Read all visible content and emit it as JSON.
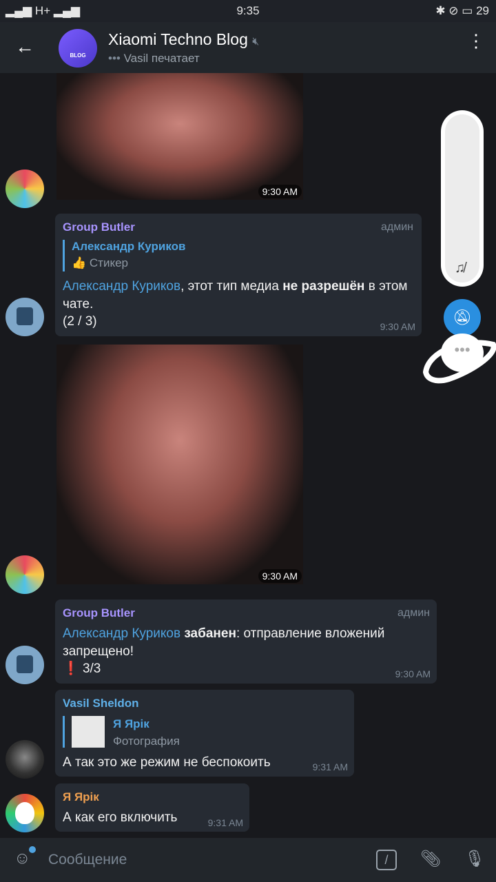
{
  "status_bar": {
    "left": "H+",
    "time": "9:35",
    "battery": "29"
  },
  "header": {
    "title": "Xiaomi Techno Blog",
    "subtitle": "Vasil печатает",
    "avatar_text": "BLOG"
  },
  "messages": {
    "m1": {
      "time": "9:30 AM"
    },
    "m2": {
      "sender": "Group Butler",
      "badge": "админ",
      "quote_author": "Александр Куриков",
      "quote_text": "Стикер",
      "link": "Александр Куриков",
      "text1": ", этот тип медиа ",
      "bold": "не разрешён",
      "text2": " в этом чате.",
      "counter": "(2  /  3)",
      "time": "9:30 AM"
    },
    "m3": {
      "time": "9:30 AM"
    },
    "m4": {
      "sender": "Group Butler",
      "badge": "админ",
      "link": "Александр Куриков",
      "bold": "забанен",
      "text": ": отправление вложений запрещено!",
      "counter": "3/3",
      "time": "9:30 AM"
    },
    "m5": {
      "sender": "Vasil Sheldon",
      "quote_author": "Я Ярік",
      "quote_text": "Фотография",
      "text": "А так это же режим не беспокоить",
      "time": "9:31 AM"
    },
    "m6": {
      "sender": "Я Ярік",
      "text": "А как его включить",
      "time": "9:31 AM"
    }
  },
  "input": {
    "placeholder": "Сообщение"
  },
  "colors": {
    "accent": "#4fa3e0",
    "butler": "#a894ff",
    "vasil": "#5fb0e8",
    "yarik": "#f0a050"
  }
}
